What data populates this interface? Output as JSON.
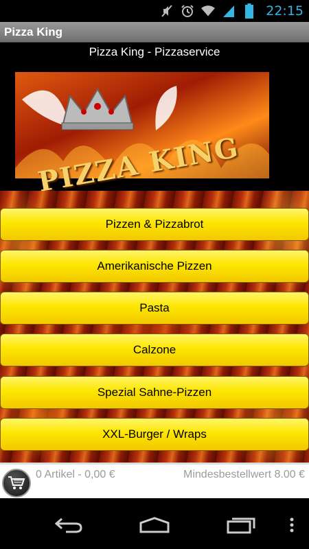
{
  "status": {
    "time": "22:15",
    "icons": [
      "mute-icon",
      "alarm-icon",
      "wifi-icon",
      "signal-icon",
      "battery-icon"
    ],
    "time_color": "#33b5e5"
  },
  "app": {
    "title": "Pizza King"
  },
  "header": {
    "title": "Pizza King - Pizzaservice",
    "logo_text": "PIZZA KING"
  },
  "menu": {
    "items": [
      {
        "label": "Pizzen & Pizzabrot"
      },
      {
        "label": "Amerikanische Pizzen"
      },
      {
        "label": "Pasta"
      },
      {
        "label": "Calzone"
      },
      {
        "label": "Spezial Sahne-Pizzen"
      },
      {
        "label": "XXL-Burger / Wraps"
      }
    ],
    "button_color": "#fde600"
  },
  "cart": {
    "summary": "0 Artikel - 0,00 €",
    "minimum": "Mindesbestellwert 8.00 €"
  },
  "nav": {
    "icons": [
      "back-icon",
      "home-icon",
      "recent-apps-icon",
      "menu-overflow-icon"
    ]
  }
}
